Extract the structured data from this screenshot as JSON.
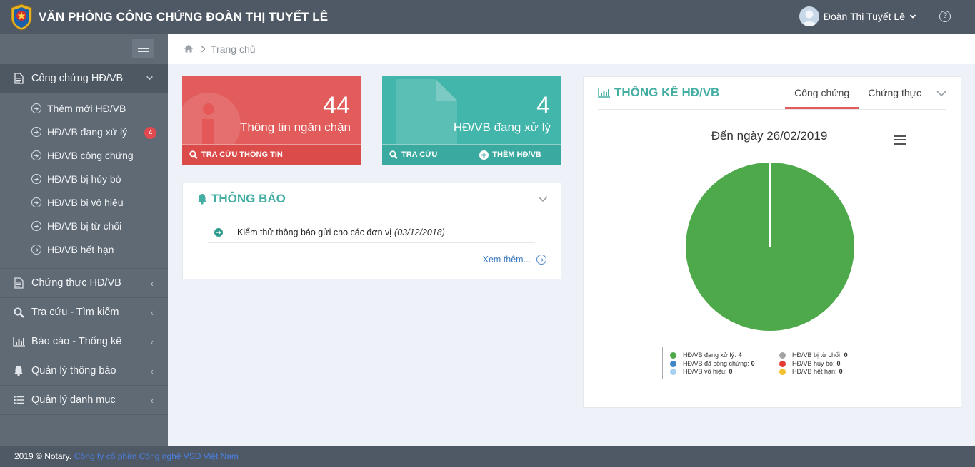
{
  "header": {
    "title": "VĂN PHÒNG CÔNG CHỨNG ĐOÀN THỊ TUYẾT LÊ",
    "user_name": "Đoàn Thị Tuyết Lê",
    "help_label": "?"
  },
  "sidebar": {
    "groups": [
      {
        "label": "Công chứng HĐ/VB",
        "icon": "document-icon",
        "expanded": true
      },
      {
        "label": "Chứng thực HĐ/VB",
        "icon": "document-icon"
      },
      {
        "label": "Tra cứu - Tìm kiếm",
        "icon": "search-icon"
      },
      {
        "label": "Báo cáo - Thống kê",
        "icon": "bar-chart-icon"
      },
      {
        "label": "Quản lý thông báo",
        "icon": "bell-icon"
      },
      {
        "label": "Quản lý danh mục",
        "icon": "list-icon"
      }
    ],
    "submenu": [
      {
        "label": "Thêm mới HĐ/VB"
      },
      {
        "label": "HĐ/VB đang xử lý",
        "badge": "4"
      },
      {
        "label": "HĐ/VB công chứng"
      },
      {
        "label": "HĐ/VB bị hủy bỏ"
      },
      {
        "label": "HĐ/VB bị vô hiệu"
      },
      {
        "label": "HĐ/VB bị từ chối"
      },
      {
        "label": "HĐ/VB hết hạn"
      }
    ]
  },
  "breadcrumb": {
    "current": "Trang chủ"
  },
  "cards": {
    "blocked": {
      "count": "44",
      "label": "Thông tin ngăn chặn",
      "action": "TRA CỨU THÔNG TIN",
      "color": "#e15c5a"
    },
    "processing": {
      "count": "4",
      "label": "HĐ/VB đang xử lý",
      "action_search": "TRA CỨU",
      "action_add": "THÊM HĐ/VB",
      "color": "#43b6ac"
    }
  },
  "notice": {
    "title": "THÔNG BÁO",
    "items": [
      {
        "text": "Kiểm thử thông báo gửi cho các đơn vị",
        "date": "(03/12/2018)"
      }
    ],
    "see_more": "Xem thêm..."
  },
  "stats": {
    "title": "THỐNG KÊ HĐ/VB",
    "tabs": [
      "Công chứng",
      "Chứng thực"
    ],
    "active_tab": "Công chứng"
  },
  "chart_data": {
    "type": "pie",
    "title": "Đến ngày 26/02/2019",
    "series": [
      {
        "name": "HĐ/VB đang xử lý",
        "value": 4,
        "color": "#4ea94a"
      },
      {
        "name": "HĐ/VB bị từ chối",
        "value": 0,
        "color": "#a4a4a4"
      },
      {
        "name": "HĐ/VB đã công chứng",
        "value": 0,
        "color": "#3e86c8"
      },
      {
        "name": "HĐ/VB hủy bỏ",
        "value": 0,
        "color": "#e53935"
      },
      {
        "name": "HĐ/VB vô hiệu",
        "value": 0,
        "color": "#a8d0f0"
      },
      {
        "name": "HĐ/VB hết hạn",
        "value": 0,
        "color": "#f2c12e"
      }
    ],
    "legend": "bottom"
  },
  "footer": {
    "copyright": "2019 © Notary.",
    "company": "Công ty cổ phần Công nghệ VSD Việt Nam"
  }
}
